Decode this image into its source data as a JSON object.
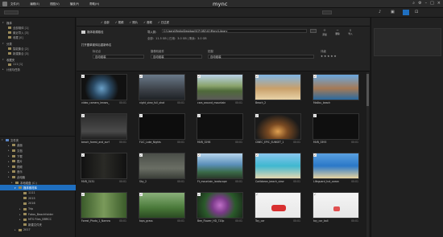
{
  "app": {
    "brand": "mync",
    "menus": [
      "文件(F)",
      "编辑(E)",
      "视图(V)",
      "播放(P)",
      "帮助(H)"
    ]
  },
  "filter": {
    "items": [
      "全部",
      "视频",
      "照片",
      "音频",
      "已过滤"
    ]
  },
  "import": {
    "source_label": "媒体卷源路径",
    "import_label": "导入到：",
    "import_path": "C:\\Users\\Media\\Desktop\\SCP-082\\41\\Mync\\Library",
    "info_line": "全部：11.5 GB | 已用：3.0 GB | 剩余：3.0 GB",
    "rename_label": "打开图单媒体后重新命名",
    "col_headers": [
      "标记点",
      "摄像机组件",
      "拍摄",
      "评级"
    ],
    "col_values": [
      "自动组装",
      "自动组装",
      "自动组装"
    ],
    "side_buttons": [
      "添加",
      "删除",
      "导入"
    ]
  },
  "sidebar": {
    "sections": [
      {
        "label": "媒体",
        "items": [
          "全部媒体 [1]",
          "最近导入 [3]",
          "收藏 [0]"
        ]
      },
      {
        "label": "分类",
        "items": [
          "智能集合 [2]",
          "新建集合 [3]"
        ]
      },
      {
        "label": "收藏夹",
        "items": [
          "111 [1]"
        ]
      },
      {
        "label": "计划与任务",
        "items": []
      }
    ],
    "tree": [
      "文件夹",
      "桌面",
      "文档",
      "下载",
      "图片",
      "视频",
      "音乐",
      "此电脑",
      "本地磁盘 (C:)",
      "媒体素材库",
      "1111",
      "2015",
      "2016",
      "Trip",
      "Fotos_Beachfolder",
      "MTS Files_BRRCC",
      "新建文件夹",
      "2017"
    ]
  },
  "thumbs": [
    {
      "name": "video_camera_lenses_",
      "dur": "00:01"
    },
    {
      "name": "night_view_full_shot",
      "dur": "00:01"
    },
    {
      "name": "cars_around_mountain",
      "dur": "00:01"
    },
    {
      "name": "Beach_2",
      "dur": ""
    },
    {
      "name": "Malibu_beach",
      "dur": ""
    },
    {
      "name": "beach_forest_and_surf",
      "dur": "00:01"
    },
    {
      "name": "FLIC_Lake_Nights",
      "dur": "00:01"
    },
    {
      "name": "MVB_3298",
      "dur": "00:01"
    },
    {
      "name": "CINEC_EPIC_SUNSET_1",
      "dur": "00:01"
    },
    {
      "name": "MVB_3393",
      "dur": "00:01"
    },
    {
      "name": "MVB_3131",
      "dur": "00:01"
    },
    {
      "name": "Sky_2",
      "dur": "00:01"
    },
    {
      "name": "Ft_mountain_landscape",
      "dur": "00:01"
    },
    {
      "name": "Caribbean_beach_view",
      "dur": "00:01"
    },
    {
      "name": "Lifeguard_hut_ocean",
      "dur": "00:01"
    },
    {
      "name": "Forest_Photo_1_Narrow",
      "dur": "00:01"
    },
    {
      "name": "tops_grass",
      "dur": "00:01"
    },
    {
      "name": "Bee_Flower_HD_720p",
      "dur": "00:01"
    },
    {
      "name": "Toy_car",
      "dur": "00:01"
    },
    {
      "name": "toy_car_ball",
      "dur": "00:01"
    }
  ]
}
